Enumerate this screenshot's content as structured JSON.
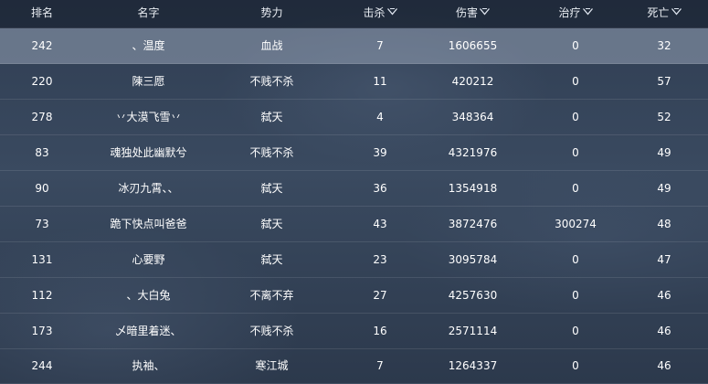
{
  "header": {
    "rank": "排名",
    "name": "名字",
    "faction": "势力",
    "kills": "击杀",
    "damage": "伤害",
    "heal": "治疗",
    "death": "死亡"
  },
  "highlight_color": "#96a2b6",
  "rows": [
    {
      "rank": "242",
      "name": "、温度",
      "faction": "血战",
      "kills": "7",
      "damage": "1606655",
      "heal": "0",
      "death": "32"
    },
    {
      "rank": "220",
      "name": "陳三愿",
      "faction": "不贱不杀",
      "kills": "11",
      "damage": "420212",
      "heal": "0",
      "death": "57"
    },
    {
      "rank": "278",
      "name": "丷大漠飞雪丷",
      "faction": "弑天",
      "kills": "4",
      "damage": "348364",
      "heal": "0",
      "death": "52"
    },
    {
      "rank": "83",
      "name": "魂独处此幽默兮",
      "faction": "不贱不杀",
      "kills": "39",
      "damage": "4321976",
      "heal": "0",
      "death": "49"
    },
    {
      "rank": "90",
      "name": "冰刃九霄、、",
      "faction": "弑天",
      "kills": "36",
      "damage": "1354918",
      "heal": "0",
      "death": "49"
    },
    {
      "rank": "73",
      "name": "跪下快点叫爸爸",
      "faction": "弑天",
      "kills": "43",
      "damage": "3872476",
      "heal": "300274",
      "death": "48"
    },
    {
      "rank": "131",
      "name": "心要野",
      "faction": "弑天",
      "kills": "23",
      "damage": "3095784",
      "heal": "0",
      "death": "47"
    },
    {
      "rank": "112",
      "name": "、大白兔",
      "faction": "不离不弃",
      "kills": "27",
      "damage": "4257630",
      "heal": "0",
      "death": "46"
    },
    {
      "rank": "173",
      "name": "乄暗里着迷、",
      "faction": "不贱不杀",
      "kills": "16",
      "damage": "2571114",
      "heal": "0",
      "death": "46"
    },
    {
      "rank": "244",
      "name": "执袖、",
      "faction": "寒江城",
      "kills": "7",
      "damage": "1264337",
      "heal": "0",
      "death": "46"
    }
  ]
}
